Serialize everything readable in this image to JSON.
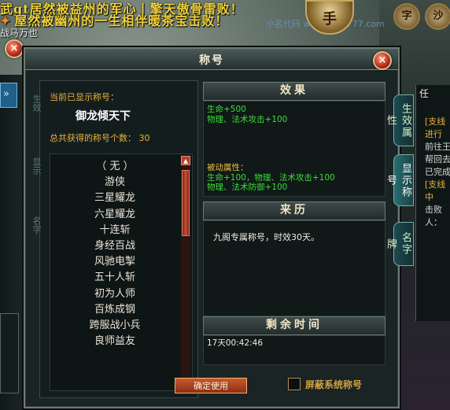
{
  "banner": {
    "line1": "武gt居然被益州的军心丨擎天傲骨雷败！",
    "line2_icon": "✦",
    "line2": "屋然被幽州的一生相伴暖茶宝击败！",
    "small": "战马万也",
    "watermark": "小名代码 www.xxds777.com",
    "emblem": "手"
  },
  "top_icons": [
    "字",
    "沙"
  ],
  "dialog": {
    "title": "称号",
    "current_label": "当前已显示称号：",
    "current_title": "御龙倾天下",
    "count_label": "总共获得的称号个数：",
    "count_value": "30",
    "titles": [
      "（ 无 ）",
      "游侠",
      "三星耀龙",
      "六星耀龙",
      "十连斩",
      "身经百战",
      "风驰电掣",
      "五十人斩",
      "初为人师",
      "百炼成钢",
      "跨服战小兵",
      "良师益友"
    ],
    "effect_header": "效果",
    "effect_lines": [
      "生命+500",
      "物理、法术攻击+100"
    ],
    "passive_label": "被动属性：",
    "passive_lines": [
      "生命+100，物理、法术攻击+100",
      "物理、法术防御+100"
    ],
    "source_header": "来历",
    "source_text": "九阁专属称号，时效30天。",
    "time_header": "剩余时间",
    "time_value": "17天00:42:46",
    "confirm": "确定使用",
    "hide_system": "屏蔽系统称号"
  },
  "side_tabs": [
    "生效属性",
    "显示称号",
    "名字牌"
  ],
  "left_strip_tabs": [
    "生效",
    "显示",
    "名字"
  ],
  "quest": {
    "header": "任",
    "lines": [
      {
        "text": "[支线",
        "color": "#e6b23a"
      },
      {
        "text": "进行",
        "color": "#e6b23a"
      },
      {
        "text": "前往王",
        "color": "#d8d8d8"
      },
      {
        "text": "帮回去",
        "color": "#d8d8d8"
      },
      {
        "text": "已完成",
        "color": "#d8d8d8"
      },
      {
        "text": "[支线",
        "color": "#e6b23a"
      },
      {
        "text": "中",
        "color": "#e6b23a"
      },
      {
        "text": "击败",
        "color": "#d8d8d8"
      },
      {
        "text": "人：",
        "color": "#d8d8d8"
      }
    ]
  }
}
